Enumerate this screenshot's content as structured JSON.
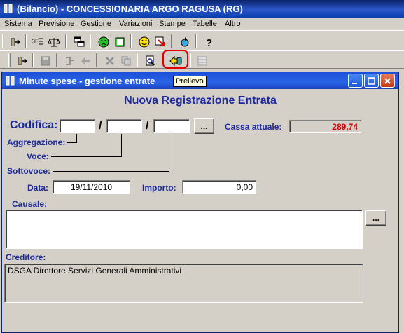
{
  "app": {
    "title": "(Bilancio) - CONCESSIONARIA ARGO RAGUSA (RG)"
  },
  "menu": [
    "Sistema",
    "Previsione",
    "Gestione",
    "Variazioni",
    "Stampe",
    "Tabelle",
    "Altro"
  ],
  "toolbar": {
    "tooltip": "Prelievo",
    "icons_row1": [
      "exit-icon",
      "budget-list-icon",
      "scale-icon",
      "windows-icon",
      "sad-face-icon",
      "document-green-icon",
      "smiley-icon",
      "arrow-doc-icon",
      "refresh-icon",
      "help-icon"
    ],
    "icons_row2": [
      "exit-icon",
      "save-icon",
      "fork-icon",
      "arrows-icon",
      "delete-icon",
      "copy-icon",
      "search-doc-icon",
      "withdrawal-icon",
      "grid-icon"
    ]
  },
  "child": {
    "title": "Minute spese - gestione entrate",
    "heading": "Nuova Registrazione Entrata",
    "codifica_label": "Codifica:",
    "codifica": [
      "",
      "",
      ""
    ],
    "slash": "/",
    "aggregazione_label": "Aggregazione:",
    "voce_label": "Voce:",
    "sottovoce_label": "Sottovoce:",
    "lookup_button": "...",
    "cassa_label": "Cassa attuale:",
    "cassa_value": "289,74",
    "data_label": "Data:",
    "data_value": "19/11/2010",
    "importo_label": "Importo:",
    "importo_value": "0,00",
    "causale_label": "Causale:",
    "causale_value": "",
    "creditore_label": "Creditore:",
    "creditore_value": "DSGA Direttore Servizi Generali Amministrativi"
  },
  "colors": {
    "label_blue": "#1c2a9c",
    "amount_red": "#d40000",
    "titlebar": "#0a246a"
  }
}
